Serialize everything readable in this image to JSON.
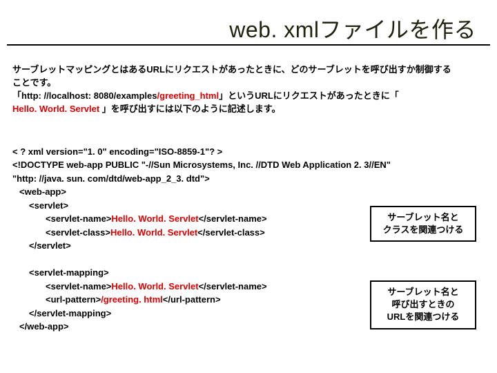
{
  "title": "web. xmlファイルを作る",
  "desc": {
    "p1a": "サーブレットマッピングとはあるURLにリクエストがあったときに、どのサーブレットを呼び出すか制御する",
    "p1b": "ことです。",
    "p2a": "「http: //localhost: 8080/examples",
    "p2b": "/greeting_html",
    "p2c": "」というURLにリクエストがあったときに「",
    "p3a": "Hello. World. Servlet ",
    "p3b": "」を呼び出すには以下のように記述します。"
  },
  "code": {
    "l1": "< ? xml version=\"1. 0\" encoding=\"ISO-8859-1\"? >",
    "l2": "<!DOCTYPE web-app PUBLIC \"-//Sun Microsystems, Inc. //DTD Web Application 2. 3//EN\"",
    "l3": "\"http: //java. sun. com/dtd/web-app_2_3. dtd\">",
    "l4": "<web-app>",
    "l5": "<servlet>",
    "l6a": "<servlet-name>",
    "l6b": "Hello. World. Servlet",
    "l6c": "</servlet-name>",
    "l7a": "<servlet-class>",
    "l7b": "Hello. World. Servlet",
    "l7c": "</servlet-class>",
    "l8": "</servlet>",
    "l9": "<servlet-mapping>",
    "l10a": "<servlet-name>",
    "l10b": "Hello. World. Servlet",
    "l10c": "</servlet-name>",
    "l11a": "<url-pattern>",
    "l11b": "/greeting. html",
    "l11c": "</url-pattern>",
    "l12": "</servlet-mapping>",
    "l13": "</web-app>"
  },
  "boxes": {
    "b1l1": "サーブレット名と",
    "b1l2": "クラスを関連つける",
    "b2l1": "サーブレット名と",
    "b2l2": "呼び出すときの",
    "b2l3": "URLを関連つける"
  }
}
